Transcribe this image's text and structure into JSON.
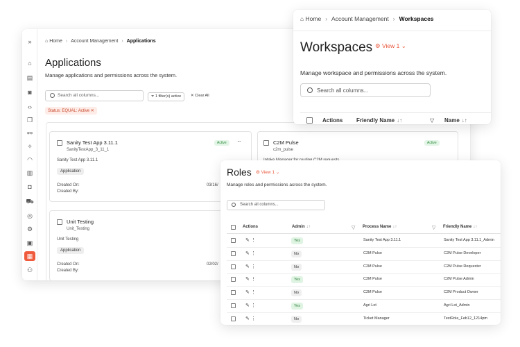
{
  "applications": {
    "breadcrumb": {
      "home": "Home",
      "section": "Account Management",
      "current": "Applications"
    },
    "title": "Applications",
    "subtitle": "Manage applications and permissions across the system.",
    "search_placeholder": "Search all columns...",
    "filter_label": "1 filter(s) active",
    "clear_all": "Clear All",
    "status_chip": "Status: EQUAL: Active",
    "cards": [
      {
        "title": "Sanity Test App 3.11.1",
        "code": "SanityTestApp_3_11_1",
        "description": "Sanity Test App 3.11.1",
        "tag": "Application",
        "badge": "Active",
        "created_on_label": "Created On:",
        "created_by_label": "Created By:",
        "date": "03/16/"
      },
      {
        "title": "C2M Pulse",
        "code": "c2m_pulse",
        "description": "Intake Manager for routing C2M requests",
        "badge": "Active"
      },
      {
        "title": "Unit Testing",
        "code": "Unit_Testing",
        "description": "Unit Testing",
        "tag": "Application",
        "created_on_label": "Created On:",
        "created_by_label": "Created By:",
        "date": "02/02/"
      }
    ]
  },
  "workspaces": {
    "breadcrumb": {
      "home": "Home",
      "section": "Account Management",
      "current": "Workspaces"
    },
    "title": "Workspaces",
    "view": "View 1",
    "subtitle": "Manage workspace and permissions across the system.",
    "search_placeholder": "Search all columns...",
    "columns": [
      "Actions",
      "Friendly Name",
      "Name"
    ]
  },
  "roles": {
    "title": "Roles",
    "view": "View 1",
    "subtitle": "Manage roles and permissions across the system.",
    "search_placeholder": "Search all columns...",
    "columns": [
      "Actions",
      "Admin",
      "Process Name",
      "Friendly Name"
    ],
    "rows": [
      {
        "admin": "Yes",
        "process": "Sanity Test App 3.11.1",
        "friendly": "Sanity Test App 3.11.1_Admin"
      },
      {
        "admin": "No",
        "process": "C2M Pulse",
        "friendly": "C2M Pulse Developer"
      },
      {
        "admin": "No",
        "process": "C2M Pulse",
        "friendly": "C2M Pulse Requester"
      },
      {
        "admin": "Yes",
        "process": "C2M Pulse",
        "friendly": "C2M Pulse Admin"
      },
      {
        "admin": "No",
        "process": "C2M Pulse",
        "friendly": "C2M Product Owner"
      },
      {
        "admin": "Yes",
        "process": "Agri Lot",
        "friendly": "Agri Lot_Admin"
      },
      {
        "admin": "No",
        "process": "Ticket Manager",
        "friendly": "TestRole_Feb12_1214pm"
      }
    ]
  },
  "colors": {
    "accent": "#f05a3c",
    "active_green": "#2e8b3e"
  }
}
